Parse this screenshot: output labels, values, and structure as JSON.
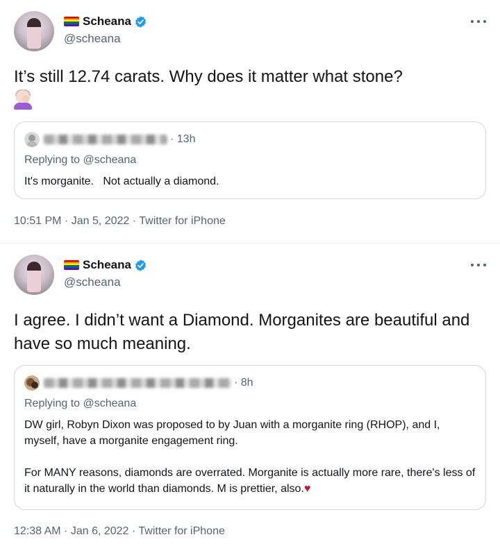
{
  "tweets": [
    {
      "author": {
        "display_name": "Scheana",
        "handle": "@scheana",
        "flag_icon": "rainbow-flag-icon",
        "verified": true
      },
      "text": "It’s still 12.74 carats. Why does it matter what stone?",
      "emoji": "woman-facepalming-emoji",
      "quote": {
        "time": "· 13h",
        "replying": "Replying to @scheana",
        "text": "It's morganite.   Not actually a diamond."
      },
      "meta": "10:51 PM · Jan 5, 2022 · Twitter for iPhone"
    },
    {
      "author": {
        "display_name": "Scheana",
        "handle": "@scheana",
        "flag_icon": "rainbow-flag-icon",
        "verified": true
      },
      "text": "I agree. I didn’t want a Diamond. Morganites are beautiful and have so much meaning.",
      "quote": {
        "time": "· 8h",
        "replying": "Replying to @scheana",
        "text": "DW girl, Robyn Dixon was proposed to by Juan with a morganite ring (RHOP), and I, myself, have a morganite engagement ring.\n\nFor MANY reasons, diamonds are overrated. Morganite is actually more rare, there's less of it naturally in the world than diamonds. M is prettier, also.",
        "heart": "♥"
      },
      "meta": "12:38 AM · Jan 6, 2022 · Twitter for iPhone"
    }
  ],
  "colors": {
    "verified_blue": "#1d9bf0",
    "secondary_text": "#536471",
    "border": "#cfd9de",
    "heart": "#c5162f"
  }
}
